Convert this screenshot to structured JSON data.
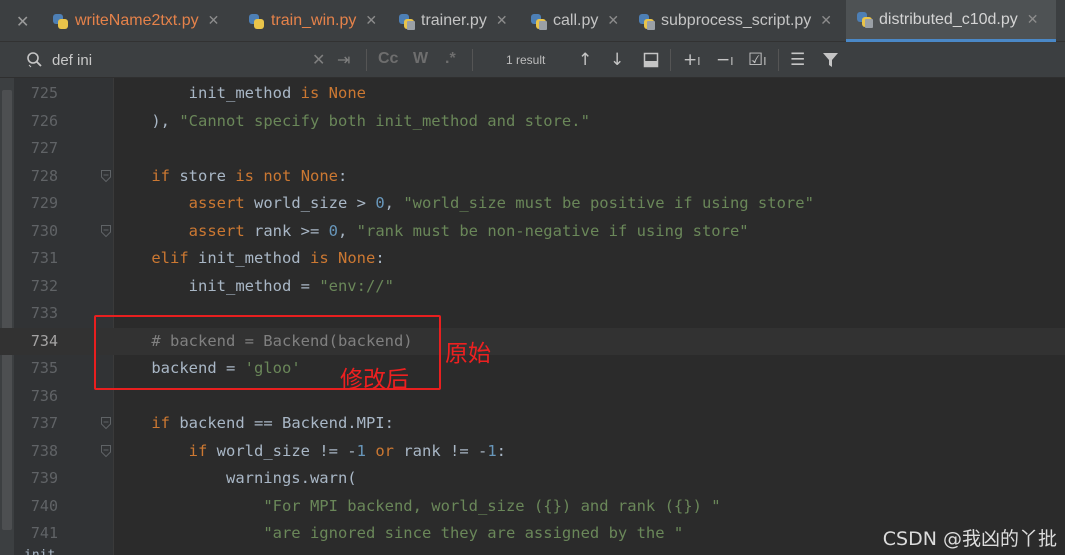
{
  "tabs": [
    {
      "label": "writeName2txt.py",
      "state": "modified"
    },
    {
      "label": "train_win.py",
      "state": "modified"
    },
    {
      "label": "trainer.py",
      "state": "normal"
    },
    {
      "label": "call.py",
      "state": "normal"
    },
    {
      "label": "subprocess_script.py",
      "state": "normal"
    },
    {
      "label": "distributed_c10d.py",
      "state": "active"
    }
  ],
  "search": {
    "query": "def ini",
    "result_count": "1 result",
    "match_case": "Cc",
    "words": "W",
    "regex": ".*"
  },
  "icons": {
    "search": "search-icon",
    "close": "close-icon",
    "replace": "replace-icon",
    "prev": "arrow-up-icon",
    "next": "arrow-down-icon",
    "select_all": "select-all-occurrences-icon",
    "add_occurrence": "add-occurrence-icon",
    "remove_occurrence": "remove-occurrence-icon",
    "toggle_occurrences": "toggle-occurrences-icon",
    "options": "search-options-icon",
    "filter": "filter-icon"
  },
  "editor": {
    "current_line": "734",
    "lines": [
      {
        "num": "725",
        "code": "        init_method is None"
      },
      {
        "num": "726",
        "code": "    ), \"Cannot specify both init_method and store.\""
      },
      {
        "num": "727",
        "code": ""
      },
      {
        "num": "728",
        "code": "    if store is not None:"
      },
      {
        "num": "729",
        "code": "        assert world_size > 0, \"world_size must be positive if using store\""
      },
      {
        "num": "730",
        "code": "        assert rank >= 0, \"rank must be non-negative if using store\""
      },
      {
        "num": "731",
        "code": "    elif init_method is None:"
      },
      {
        "num": "732",
        "code": "        init_method = \"env://\""
      },
      {
        "num": "733",
        "code": ""
      },
      {
        "num": "734",
        "code": "    # backend = Backend(backend)"
      },
      {
        "num": "735",
        "code": "    backend = 'gloo'"
      },
      {
        "num": "736",
        "code": ""
      },
      {
        "num": "737",
        "code": "    if backend == Backend.MPI:"
      },
      {
        "num": "738",
        "code": "        if world_size != -1 or rank != -1:"
      },
      {
        "num": "739",
        "code": "            warnings.warn("
      },
      {
        "num": "740",
        "code": "                \"For MPI backend, world_size ({}) and rank ({}) \""
      },
      {
        "num": "741",
        "code": "                \"are ignored since they are assigned by the \""
      }
    ],
    "bottom_partial": "init"
  },
  "annotation": {
    "original_label": "原始",
    "modified_label": "修改后",
    "color": "#e81f1f"
  },
  "watermark": "CSDN @我凶的丫批",
  "colors": {
    "keyword": "#cc7832",
    "string": "#6a8759",
    "number": "#6897bb",
    "comment": "#808080",
    "text": "#a9b7c6",
    "tab_modified": "#e5824a",
    "tab_active_underline": "#4a88c7"
  }
}
